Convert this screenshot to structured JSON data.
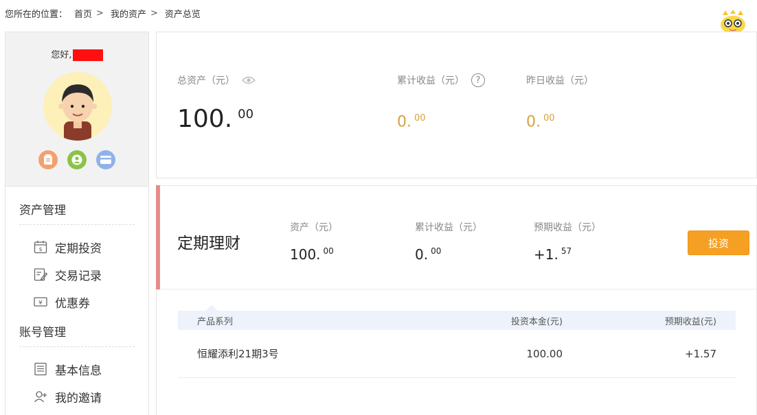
{
  "breadcrumb": {
    "prefix": "您所在的位置：",
    "items": [
      "首页",
      "我的资产",
      "资产总览"
    ],
    "separator": ">"
  },
  "profile": {
    "greeting": "您好,"
  },
  "sidebar": {
    "sections": [
      {
        "title": "资产管理",
        "items": [
          {
            "label": "定期投资",
            "icon": "calendar-money-icon"
          },
          {
            "label": "交易记录",
            "icon": "edit-record-icon"
          },
          {
            "label": "优惠券",
            "icon": "coupon-icon"
          }
        ]
      },
      {
        "title": "账号管理",
        "items": [
          {
            "label": "基本信息",
            "icon": "document-list-icon"
          },
          {
            "label": "我的邀请",
            "icon": "invite-user-icon"
          }
        ]
      }
    ]
  },
  "summary": {
    "total_assets_label": "总资产（元）",
    "total_assets_int": "100.",
    "total_assets_dec": "00",
    "cum_income_label": "累计收益（元）",
    "cum_income_int": "0.",
    "cum_income_dec": "00",
    "yesterday_label": "昨日收益（元）",
    "yesterday_int": "0.",
    "yesterday_dec": "00"
  },
  "product": {
    "name": "定期理财",
    "assets_label": "资产（元）",
    "assets_int": "100.",
    "assets_dec": "00",
    "cum_label": "累计收益（元）",
    "cum_int": "0.",
    "cum_dec": "00",
    "expected_label": "预期收益（元）",
    "expected_int": "+1.",
    "expected_dec": "57",
    "invest_button": "投资",
    "table": {
      "headers": [
        "产品系列",
        "投资本金(元)",
        "预期收益(元)"
      ],
      "rows": [
        [
          "恒耀添利21期3号",
          "100.00",
          "+1.57"
        ]
      ]
    }
  },
  "colors": {
    "accent_orange": "#f5a023",
    "gold_text": "#d8a13b",
    "accent_red": "#e88a8a",
    "name_mask": "#ff1010"
  }
}
